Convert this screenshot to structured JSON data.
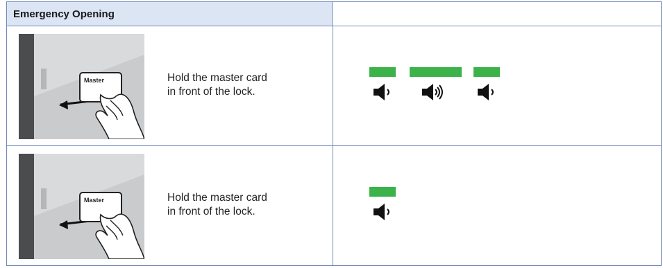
{
  "header": {
    "title": "Emergency Opening"
  },
  "rows": [
    {
      "card_label": "Master",
      "instruction_line1": "Hold the master card",
      "instruction_line2": "in front of the lock.",
      "signals": [
        {
          "light": "green",
          "duration": "short",
          "sound": "short-beep"
        },
        {
          "light": "green",
          "duration": "long",
          "sound": "long-beep"
        },
        {
          "light": "green",
          "duration": "short",
          "sound": "short-beep"
        }
      ]
    },
    {
      "card_label": "Master",
      "instruction_line1": "Hold the master card",
      "instruction_line2": "in front of the lock.",
      "signals": [
        {
          "light": "green",
          "duration": "short",
          "sound": "short-beep"
        }
      ]
    }
  ],
  "colors": {
    "header_bg": "#dbe5f4",
    "border": "#6f8bb8",
    "led_green": "#3cb24a"
  },
  "icons": [
    "master-card-hand-illustration",
    "speaker-short-icon",
    "speaker-long-icon"
  ]
}
